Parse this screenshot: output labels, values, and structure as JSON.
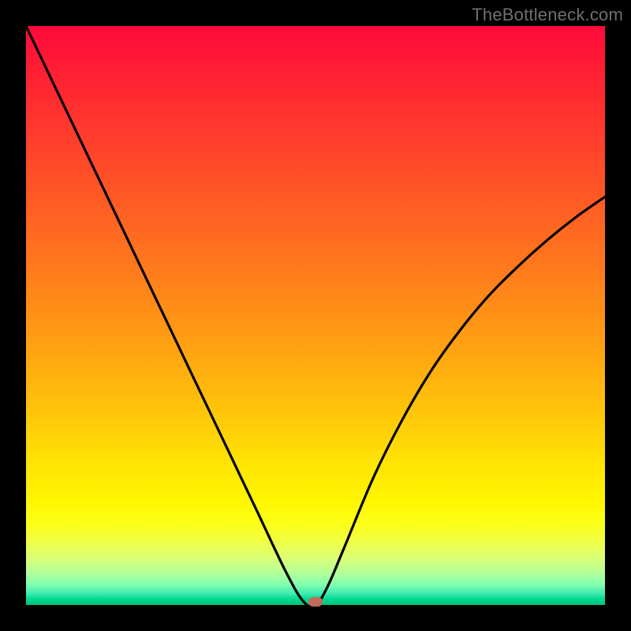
{
  "watermark": "TheBottleneck.com",
  "colors": {
    "curve_stroke": "#000000",
    "marker_fill": "#c36b5a"
  },
  "chart_data": {
    "type": "line",
    "title": "",
    "xlabel": "",
    "ylabel": "",
    "xlim": [
      0,
      100
    ],
    "ylim": [
      0,
      100
    ],
    "grid": false,
    "x": [
      0,
      5,
      10,
      15,
      20,
      25,
      30,
      35,
      40,
      45,
      48,
      50,
      52,
      55,
      60,
      65,
      70,
      75,
      80,
      85,
      90,
      95,
      100
    ],
    "values": [
      100,
      89.5,
      79,
      68.5,
      58,
      47.5,
      37,
      26.5,
      16,
      5.5,
      0.5,
      0,
      3,
      10,
      22,
      32,
      40.5,
      47.5,
      53.5,
      58.5,
      63,
      67,
      70.5
    ],
    "minimum": {
      "x": 50,
      "y": 0
    },
    "annotations": []
  }
}
